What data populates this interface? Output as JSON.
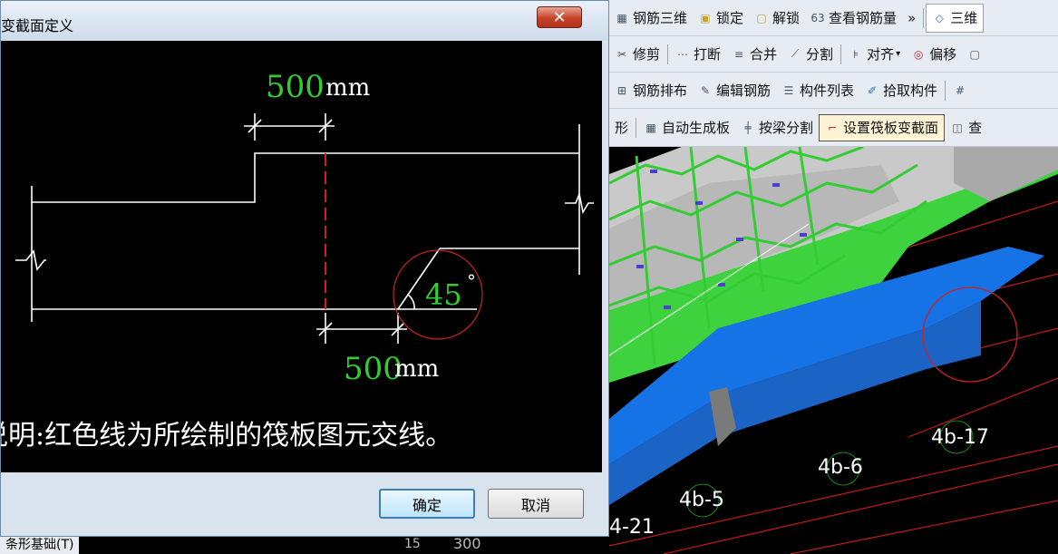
{
  "toolbar1": {
    "items": [
      {
        "label": "钢筋三维",
        "icon": "rebar-3d-icon"
      },
      {
        "label": "锁定",
        "icon": "lock-icon"
      },
      {
        "label": "解锁",
        "icon": "unlock-icon"
      },
      {
        "label": "查看钢筋量",
        "icon": "view-rebar-qty-icon"
      }
    ],
    "overflow": "»",
    "tab_label": "三维"
  },
  "toolbar2": {
    "items": [
      {
        "label": "修剪",
        "icon": "trim-icon"
      },
      {
        "label": "打断",
        "icon": "break-icon"
      },
      {
        "label": "合并",
        "icon": "merge-icon"
      },
      {
        "label": "分割",
        "icon": "split-icon"
      },
      {
        "label": "对齐",
        "icon": "align-icon"
      },
      {
        "label": "偏移",
        "icon": "offset-icon"
      }
    ]
  },
  "toolbar3": {
    "items": [
      {
        "label": "钢筋排布",
        "icon": "rebar-layout-icon"
      },
      {
        "label": "编辑钢筋",
        "icon": "edit-rebar-icon"
      },
      {
        "label": "构件列表",
        "icon": "component-list-icon"
      },
      {
        "label": "拾取构件",
        "icon": "pick-component-icon"
      }
    ]
  },
  "toolbar4": {
    "prefix": "形",
    "items": [
      {
        "label": "自动生成板",
        "icon": "auto-gen-slab-icon"
      },
      {
        "label": "按梁分割",
        "icon": "split-by-beam-icon"
      },
      {
        "label": "设置筏板变截面",
        "icon": "set-raft-section-icon",
        "active": true
      }
    ],
    "next_label": "查"
  },
  "dialog": {
    "title": "变截面定义",
    "close_label": "✕",
    "diagram": {
      "top_dim_value": "500",
      "top_dim_unit": "mm",
      "bottom_dim_value": "500",
      "bottom_dim_unit": "mm",
      "angle_value": "45",
      "angle_unit": "°"
    },
    "note": "说明:红色线为所绘制的筏板图元交线。",
    "ok_label": "确定",
    "cancel_label": "取消"
  },
  "viewport": {
    "labels": [
      "4b-17",
      "4b-6",
      "4b-5",
      "4-21",
      "15",
      "300"
    ]
  },
  "statusbar": {
    "tab_label": "条形基础(T)"
  },
  "colors": {
    "dim_green": "#33cc33",
    "highlight_red": "#cc2222",
    "slab_blue": "#1673e6",
    "slab_gray": "#bcbcbc",
    "rebar_green": "#33cc33"
  }
}
